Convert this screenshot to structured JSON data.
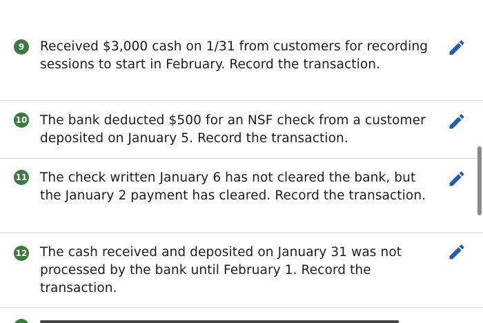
{
  "questions": [
    {
      "number": "9",
      "text": "Received $3,000 cash on 1/31 from customers for recording sessions to start in February. Record the transaction.",
      "edit_icon": "pencil-icon"
    },
    {
      "number": "10",
      "text": "The bank deducted $500 for an NSF check from a customer deposited on January 5. Record the transaction.",
      "edit_icon": "pencil-icon"
    },
    {
      "number": "11",
      "text": "The check written January 6 has not cleared the bank, but the January 2 payment has cleared. Record the transaction.",
      "edit_icon": "pencil-icon"
    },
    {
      "number": "12",
      "text": "The cash received and deposited on January 31 was not processed by the bank until February 1. Record the transaction.",
      "edit_icon": "pencil-icon"
    }
  ],
  "colors": {
    "badge": "#3d7a3f",
    "edit_icon": "#1f5fae",
    "divider": "#d9d9d9"
  }
}
